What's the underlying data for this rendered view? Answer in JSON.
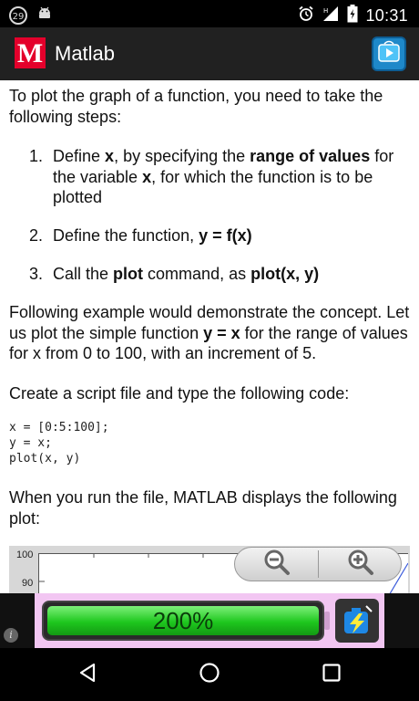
{
  "status_bar": {
    "notification_count": "29",
    "time": "10:31",
    "icons": [
      "android-icon",
      "alarm-icon",
      "signal-icon",
      "battery-icon"
    ]
  },
  "app_bar": {
    "logo_text": "M",
    "title": "Matlab",
    "action_icon": "play-store-icon"
  },
  "content": {
    "intro": "To plot the graph of a function, you need to take the following steps:",
    "steps": [
      {
        "num": "1.",
        "parts": [
          {
            "t": "Define ",
            "b": false
          },
          {
            "t": "x",
            "b": true
          },
          {
            "t": ", by specifying the ",
            "b": false
          },
          {
            "t": "range of values",
            "b": true
          },
          {
            "t": " for the variable ",
            "b": false
          },
          {
            "t": "x",
            "b": true
          },
          {
            "t": ", for which the function is to be plotted",
            "b": false
          }
        ]
      },
      {
        "num": "2.",
        "parts": [
          {
            "t": "Define the function, ",
            "b": false
          },
          {
            "t": "y = f(x)",
            "b": true
          }
        ]
      },
      {
        "num": "3.",
        "parts": [
          {
            "t": "Call the ",
            "b": false
          },
          {
            "t": "plot",
            "b": true
          },
          {
            "t": " command, as ",
            "b": false
          },
          {
            "t": "plot(x, y)",
            "b": true
          }
        ]
      }
    ],
    "example_parts": [
      {
        "t": "Following example would demonstrate the concept. Let us plot the simple function ",
        "b": false
      },
      {
        "t": "y = x",
        "b": true
      },
      {
        "t": " for the range of values for x from 0 to 100, with an increment of 5.",
        "b": false
      }
    ],
    "script_instruction": "Create a script file and type the following code:",
    "code": "x = [0:5:100];\ny = x;\nplot(x, y)",
    "run_text": "When you run the file, MATLAB displays the following plot:"
  },
  "plot_preview": {
    "y_ticks": [
      "100",
      "90"
    ],
    "zoom_out_icon": "zoom-out-icon",
    "zoom_in_icon": "zoom-in-icon"
  },
  "ad": {
    "battery_label": "200%",
    "info": "i"
  },
  "nav_bar": {
    "icons": [
      "back-icon",
      "home-icon",
      "recents-icon"
    ]
  }
}
